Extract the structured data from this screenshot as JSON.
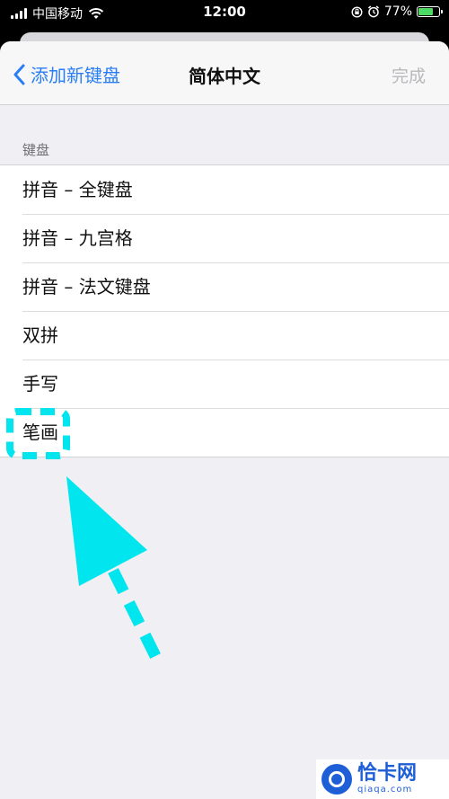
{
  "status_bar": {
    "carrier": "中国移动",
    "time": "12:00",
    "battery_percent": "77%",
    "battery_level": 0.77,
    "battery_color": "#4cd964"
  },
  "nav": {
    "back_label": "添加新键盘",
    "title": "简体中文",
    "done_label": "完成"
  },
  "section": {
    "header": "键盘",
    "items": [
      {
        "label": "拼音 – 全键盘"
      },
      {
        "label": "拼音 – 九宫格"
      },
      {
        "label": "拼音 – 法文键盘"
      },
      {
        "label": "双拼"
      },
      {
        "label": "手写"
      },
      {
        "label": "笔画"
      }
    ]
  },
  "annotation": {
    "color": "#00e5ee"
  },
  "watermark": {
    "title": "恰卡网",
    "subtitle": "qiaqa.com"
  },
  "colors": {
    "accent": "#2a7ef5",
    "disabled": "#b8b8bd",
    "background": "#efeff4"
  }
}
